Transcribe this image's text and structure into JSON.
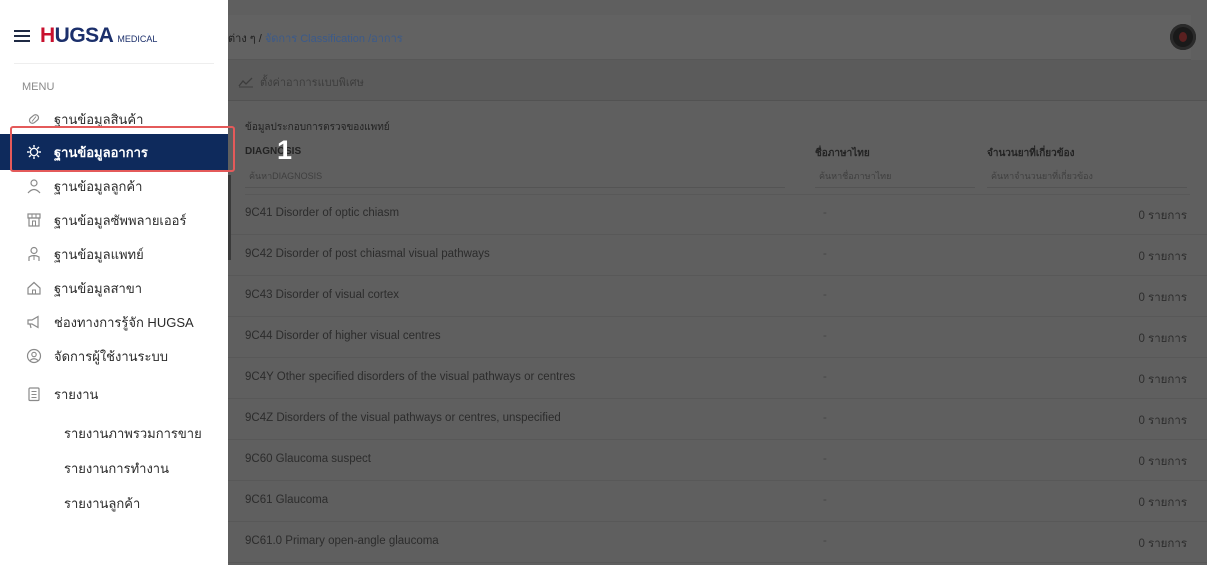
{
  "brand": {
    "name_h": "H",
    "name_rest": "UGSA",
    "sub": "MEDICAL"
  },
  "sidebar": {
    "menu_label": "MENU",
    "items": [
      {
        "label": "ฐานข้อมูลสินค้า",
        "icon": "pill-icon"
      },
      {
        "label": "ฐานข้อมูลอาการ",
        "icon": "gear-virus-icon",
        "active": true
      },
      {
        "label": "ฐานข้อมูลลูกค้า",
        "icon": "customer-icon"
      },
      {
        "label": "ฐานข้อมูลซัพพลายเออร์",
        "icon": "store-icon"
      },
      {
        "label": "ฐานข้อมูลแพทย์",
        "icon": "doctor-icon"
      },
      {
        "label": "ฐานข้อมูลสาขา",
        "icon": "home-icon"
      },
      {
        "label": "ช่องทางการรู้จัก HUGSA",
        "icon": "megaphone-icon"
      },
      {
        "label": "จัดการผู้ใช้งานระบบ",
        "icon": "user-circle-icon"
      },
      {
        "label": "รายงาน",
        "icon": "report-icon"
      }
    ],
    "sub_items": [
      "รายงานภาพรวมการขาย",
      "รายงานการทำงาน",
      "รายงานลูกค้า"
    ]
  },
  "annotation": {
    "step": "1"
  },
  "header": {
    "breadcrumb_prefix": "ต่าง ๆ / ",
    "breadcrumb_link": "จัดการ Classification /อาการ"
  },
  "tab": {
    "label": "ตั้งค่าอาการแบบพิเศษ"
  },
  "table": {
    "section_title": "ข้อมูลประกอบการตรวจของแพทย์",
    "columns": {
      "diagnosis": "DIAGNOSIS",
      "thai_name": "ชื่อภาษาไทย",
      "related_count": "จำนวนยาที่เกี่ยวข้อง"
    },
    "filters": {
      "diagnosis": "ค้นหาDIAGNOSIS",
      "thai_name": "ค้นหาชื่อภาษาไทย",
      "related_count": "ค้นหาจำนวนยาที่เกี่ยวข้อง"
    },
    "rows": [
      {
        "diagnosis": "9C41 Disorder of optic chiasm",
        "thai": "-",
        "count": "0 รายการ"
      },
      {
        "diagnosis": "9C42 Disorder of post chiasmal visual pathways",
        "thai": "-",
        "count": "0 รายการ"
      },
      {
        "diagnosis": "9C43 Disorder of visual cortex",
        "thai": "-",
        "count": "0 รายการ"
      },
      {
        "diagnosis": "9C44 Disorder of higher visual centres",
        "thai": "-",
        "count": "0 รายการ"
      },
      {
        "diagnosis": "9C4Y Other specified disorders of the visual pathways or centres",
        "thai": "-",
        "count": "0 รายการ"
      },
      {
        "diagnosis": "9C4Z Disorders of the visual pathways or centres, unspecified",
        "thai": "-",
        "count": "0 รายการ"
      },
      {
        "diagnosis": "9C60 Glaucoma suspect",
        "thai": "-",
        "count": "0 รายการ"
      },
      {
        "diagnosis": "9C61 Glaucoma",
        "thai": "-",
        "count": "0 รายการ"
      },
      {
        "diagnosis": "9C61.0 Primary open-angle glaucoma",
        "thai": "-",
        "count": "0 รายการ"
      }
    ]
  },
  "colors": {
    "sidebar_active": "#0e2a5c",
    "brand_blue": "#1b2f6b",
    "brand_red": "#c8102e",
    "highlight": "#e45a5a",
    "overlay": "#5f5f5f"
  }
}
